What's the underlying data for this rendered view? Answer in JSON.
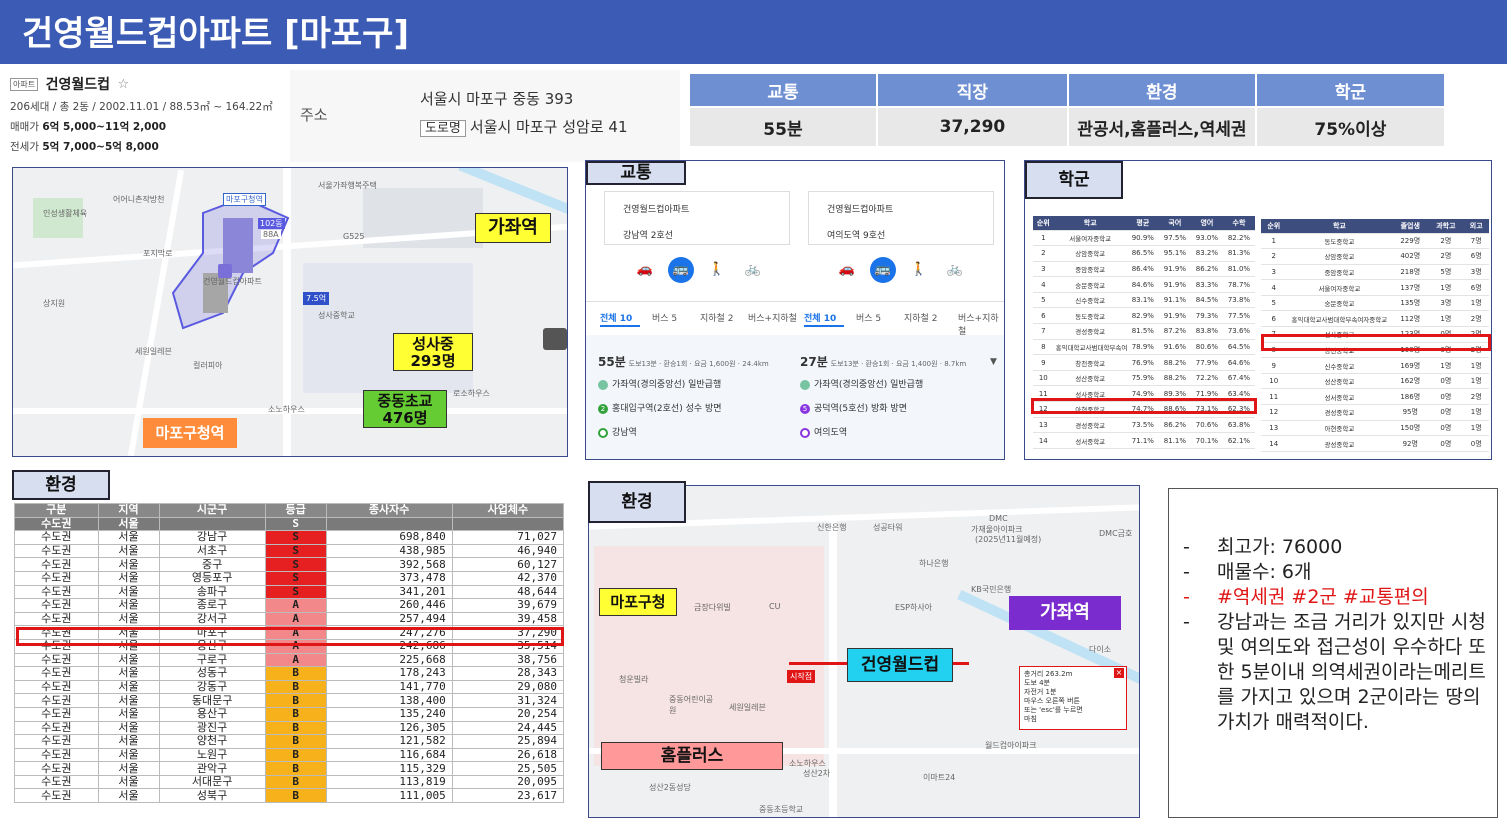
{
  "title": "건영월드컵아파트 [마포구]",
  "info": {
    "badge": "아파트",
    "name": "건영월드컵",
    "star": "☆",
    "detail": "206세대 / 총 2동 / 2002.11.01 / 88.53㎡ ~ 164.22㎡",
    "sale_label": "매매가",
    "sale_value": "6억 5,000~11억 2,000",
    "jeonse_label": "전세가",
    "jeonse_value": "5억 7,000~5억 8,000"
  },
  "address": {
    "label": "주소",
    "line1": "서울시 마포구 중동 393",
    "road_badge": "도로명",
    "line2": "서울시 마포구 성암로 41"
  },
  "summary": {
    "headers": [
      "교통",
      "직장",
      "환경",
      "학군"
    ],
    "values": [
      "55분",
      "37,290",
      "관공서,홈플러스,역세권",
      "75%이상"
    ]
  },
  "map1": {
    "tag_station": "가좌역",
    "tag_school1_name": "성사중",
    "tag_school1_count": "293명",
    "tag_school2_name": "중동초교",
    "tag_school2_count": "476명",
    "tag_office": "마포구청역",
    "labels": [
      "인성생활체육",
      "어어니촌작방천",
      "서울가좌행복주택",
      "성산로",
      "G525",
      "마포구청역",
      "포지막로",
      "102동",
      "88A",
      "건영월드컵아파트",
      "7.5억",
      "성사중학교",
      "세원일레븐",
      "컬러피아",
      "로소하우스",
      "상지원",
      "소노하우스"
    ]
  },
  "transit": {
    "label": "교통",
    "left": {
      "from": "건영월드컵아파트",
      "to": "강남역 2호선"
    },
    "right": {
      "from": "건영월드컵아파트",
      "to": "여의도역 9호선"
    },
    "tabs_left": [
      "전체 10",
      "버스 5",
      "지하철 2",
      "버스+지하철"
    ],
    "tabs_right": [
      "전체 10",
      "버스 5",
      "지하철 2",
      "버스+지하철"
    ],
    "route_left": {
      "time": "55분",
      "meta": "도보13분 · 환승1회 · 요금 1,600원 · 24.4km",
      "s1": "가좌역(경의중앙선) 일반급행",
      "s2": "홍대입구역(2호선) 성수 방면",
      "s3": "강남역",
      "badge2": "2"
    },
    "route_right": {
      "time": "27분",
      "meta": "도보13분 · 환승1회 · 요금 1,400원 · 8.7km",
      "s1": "가좌역(경의중앙선) 일반급행",
      "s2": "공덕역(5호선) 방화 방면",
      "s3": "여의도역",
      "badge2": "5"
    }
  },
  "school": {
    "label": "학군",
    "left_header": [
      "순위",
      "학교",
      "평균",
      "국어",
      "영어",
      "수학"
    ],
    "left_rows": [
      [
        "1",
        "서울여자중학교",
        "90.9%",
        "97.5%",
        "93.0%",
        "82.2%"
      ],
      [
        "2",
        "상암중학교",
        "86.5%",
        "95.1%",
        "83.2%",
        "81.3%"
      ],
      [
        "3",
        "중암중학교",
        "86.4%",
        "91.9%",
        "86.2%",
        "81.0%"
      ],
      [
        "4",
        "숭문중학교",
        "84.6%",
        "91.9%",
        "83.3%",
        "78.7%"
      ],
      [
        "5",
        "신수중학교",
        "83.1%",
        "91.1%",
        "84.5%",
        "73.8%"
      ],
      [
        "6",
        "동도중학교",
        "82.9%",
        "91.9%",
        "79.3%",
        "77.5%"
      ],
      [
        "7",
        "경성중학교",
        "81.5%",
        "87.2%",
        "83.8%",
        "73.6%"
      ],
      [
        "8",
        "홍익대학교사범대학부속여자중학교",
        "78.9%",
        "91.6%",
        "80.6%",
        "64.5%"
      ],
      [
        "9",
        "창천중학교",
        "76.9%",
        "88.2%",
        "77.9%",
        "64.6%"
      ],
      [
        "10",
        "성산중학교",
        "75.9%",
        "88.2%",
        "72.2%",
        "67.4%"
      ],
      [
        "11",
        "성사중학교",
        "74.9%",
        "89.3%",
        "71.9%",
        "63.4%"
      ],
      [
        "12",
        "아현중학교",
        "74.7%",
        "88.6%",
        "73.1%",
        "62.3%"
      ],
      [
        "13",
        "경성중학교",
        "73.5%",
        "86.2%",
        "70.6%",
        "63.8%"
      ],
      [
        "14",
        "성서중학교",
        "71.1%",
        "81.1%",
        "70.1%",
        "62.1%"
      ]
    ],
    "right_header": [
      "순위",
      "학교",
      "졸업생",
      "과학고",
      "외고"
    ],
    "right_rows": [
      [
        "1",
        "동도중학교",
        "229명",
        "2명",
        "7명"
      ],
      [
        "2",
        "상암중학교",
        "402명",
        "2명",
        "6명"
      ],
      [
        "3",
        "중암중학교",
        "218명",
        "5명",
        "3명"
      ],
      [
        "4",
        "서울여자중학교",
        "137명",
        "1명",
        "6명"
      ],
      [
        "5",
        "숭문중학교",
        "135명",
        "3명",
        "1명"
      ],
      [
        "6",
        "홍익대학교사범대학부속여자중학교",
        "112명",
        "1명",
        "2명"
      ],
      [
        "7",
        "성사중학교",
        "123명",
        "0명",
        "2명"
      ],
      [
        "8",
        "창천중학교",
        "100명",
        "0명",
        "2명"
      ],
      [
        "9",
        "신수중학교",
        "169명",
        "1명",
        "1명"
      ],
      [
        "10",
        "성산중학교",
        "162명",
        "0명",
        "1명"
      ],
      [
        "11",
        "성서중학교",
        "186명",
        "0명",
        "2명"
      ],
      [
        "12",
        "경성중학교",
        "95명",
        "0명",
        "1명"
      ],
      [
        "13",
        "아현중학교",
        "150명",
        "0명",
        "1명"
      ],
      [
        "14",
        "광성중학교",
        "92명",
        "0명",
        "0명"
      ]
    ]
  },
  "env_table": {
    "label": "환경",
    "headers": [
      "구분",
      "지역",
      "시군구",
      "등급",
      "종사자수",
      "사업체수"
    ],
    "top_row": [
      "수도권",
      "서울",
      "",
      "S",
      "",
      ""
    ],
    "rows": [
      [
        "수도권",
        "서울",
        "강남구",
        "S",
        "698,840",
        "71,027"
      ],
      [
        "수도권",
        "서울",
        "서초구",
        "S",
        "438,985",
        "46,940"
      ],
      [
        "수도권",
        "서울",
        "중구",
        "S",
        "392,568",
        "60,127"
      ],
      [
        "수도권",
        "서울",
        "영등포구",
        "S",
        "373,478",
        "42,370"
      ],
      [
        "수도권",
        "서울",
        "송파구",
        "S",
        "341,201",
        "48,644"
      ],
      [
        "수도권",
        "서울",
        "종로구",
        "A",
        "260,446",
        "39,679"
      ],
      [
        "수도권",
        "서울",
        "강서구",
        "A",
        "257,494",
        "39,458"
      ],
      [
        "수도권",
        "서울",
        "마포구",
        "A",
        "247,276",
        "37,290"
      ],
      [
        "수도권",
        "서울",
        "용산구",
        "A",
        "242,686",
        "35,514"
      ],
      [
        "수도권",
        "서울",
        "구로구",
        "A",
        "225,668",
        "38,756"
      ],
      [
        "수도권",
        "서울",
        "성동구",
        "B",
        "178,243",
        "28,343"
      ],
      [
        "수도권",
        "서울",
        "강동구",
        "B",
        "141,770",
        "29,080"
      ],
      [
        "수도권",
        "서울",
        "동대문구",
        "B",
        "138,400",
        "31,324"
      ],
      [
        "수도권",
        "서울",
        "용산구",
        "B",
        "135,240",
        "20,254"
      ],
      [
        "수도권",
        "서울",
        "광진구",
        "B",
        "126,305",
        "24,445"
      ],
      [
        "수도권",
        "서울",
        "양천구",
        "B",
        "121,582",
        "25,894"
      ],
      [
        "수도권",
        "서울",
        "노원구",
        "B",
        "116,684",
        "26,618"
      ],
      [
        "수도권",
        "서울",
        "관악구",
        "B",
        "115,329",
        "25,505"
      ],
      [
        "수도권",
        "서울",
        "서대문구",
        "B",
        "113,819",
        "20,095"
      ],
      [
        "수도권",
        "서울",
        "성북구",
        "B",
        "111,005",
        "23,617"
      ]
    ]
  },
  "map2": {
    "label": "환경",
    "tag_office": "마포구청",
    "tag_station": "가좌역",
    "tag_apt": "건영월드컵",
    "tag_mart": "홈플러스",
    "start": "시작점",
    "popup_lines": [
      "총거리 263.2m",
      "도보 4분",
      "자전거 1분",
      "마우스 오른쪽 버튼",
      "또는 'esc'를 누르면",
      "마침"
    ],
    "labels": [
      "DMC",
      "가재울아이파크",
      "(2025년11월예정)",
      "신한은행",
      "성공타워",
      "하나은행",
      "KB국민은행",
      "ESP하사아",
      "금장다위빌",
      "CU",
      "다이소",
      "청운빌라",
      "중동어린이공원",
      "세원일레븐",
      "소노하우스",
      "성산2차",
      "이마트24",
      "월드컵아이파크",
      "성산2동성당",
      "중동초등학교",
      "DMC금호"
    ]
  },
  "notes": {
    "items": [
      {
        "text": "최고가: 76000",
        "red": false
      },
      {
        "text": "매물수: 6개",
        "red": false
      },
      {
        "text": "#역세권 #2군 #교통편의",
        "red": true
      },
      {
        "text": "강남과는 조금 거리가 있지만 시청및 여의도와 접근성이 우수하다 또한 5분이내 의역세권이라는메리트를 가지고 있으며 2군이라는 땅의 가치가 매력적이다.",
        "red": false
      }
    ]
  },
  "colors": {
    "title_bg": "#3b5bb5",
    "summary_header": "#6f8fd3",
    "highlight_red": "#e01515",
    "grade_S": "#e62020",
    "grade_A": "#f2888a",
    "grade_B": "#f7b21b"
  }
}
